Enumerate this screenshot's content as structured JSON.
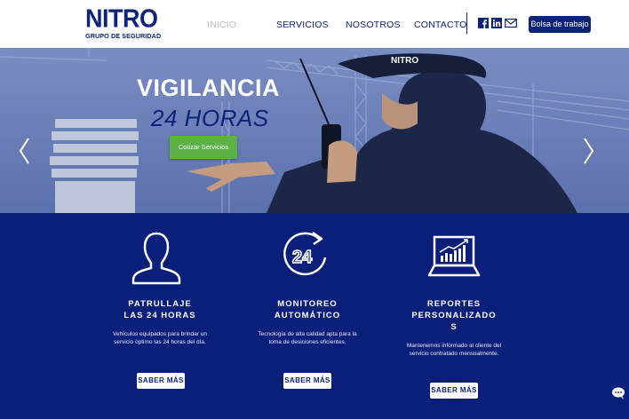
{
  "header": {
    "logo_main": "NITRO",
    "logo_sub": "GRUPO DE SEGURIDAD",
    "nav": [
      {
        "label": "INICIO",
        "active": true
      },
      {
        "label": "SERVICIOS",
        "active": false
      },
      {
        "label": "NOSOTROS",
        "active": false
      },
      {
        "label": "CONTACTO",
        "active": false
      }
    ],
    "social_icons": [
      "facebook-icon",
      "linkedin-icon",
      "mail-icon"
    ],
    "cta_label": "Bolsa de trabajo"
  },
  "hero": {
    "title_line1": "VIGILANCIA",
    "title_line2_num": "24",
    "title_line2_word": "HORAS",
    "button_label": "Cotizar Servicios",
    "cap_text": "NITRO"
  },
  "services": [
    {
      "icon": "person-icon",
      "title_line1": "PATRULLAJE",
      "title_line2": "LAS 24 HORAS",
      "desc_line1": "Vehículos equipados para brindar un",
      "desc_line2": "servicio óptimo las 24 horas del día.",
      "button": "SABER MÁS"
    },
    {
      "icon": "clock-24-icon",
      "title_line1": "MONITOREO",
      "title_line2": "AUTOMÁTICO",
      "desc_line1": "Tecnología de alta calidad apta para la",
      "desc_line2": "toma de desiciones eficientes.",
      "button": "SABER MÁS"
    },
    {
      "icon": "chart-monitor-icon",
      "title_line1": "REPORTES",
      "title_line2": "PERSONALIZADO",
      "title_line3": "S",
      "desc_line1": "Mantenemos informado al cliente del",
      "desc_line2": "servicio contratado mensualmente.",
      "button": "SABER MÁS"
    }
  ],
  "colors": {
    "brand_navy": "#0a1f7a",
    "cta_green": "#5cb345",
    "nav_inactive": "#b9bdc6"
  }
}
